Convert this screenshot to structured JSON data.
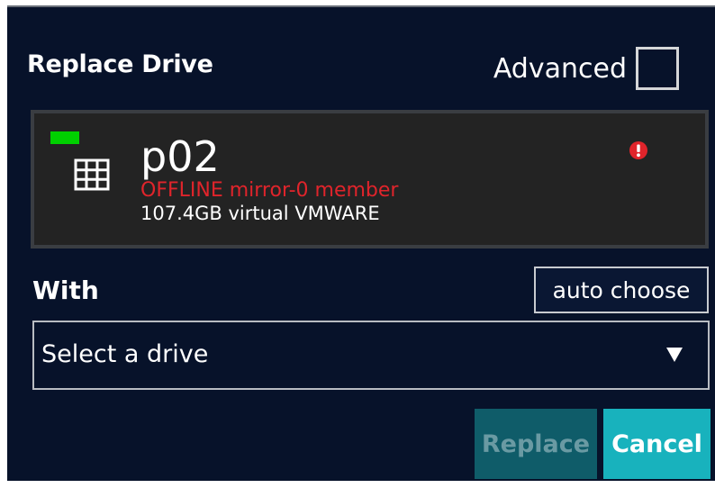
{
  "dialog": {
    "title": "Replace Drive",
    "advanced": {
      "label": "Advanced",
      "checked": false
    }
  },
  "drive": {
    "name": "p02",
    "status": "OFFLINE mirror-0 member",
    "info": "107.4GB virtual VMWARE",
    "status_led_color": "#00d000",
    "status_text_color": "#e0242b",
    "icons": {
      "device": "grid-icon",
      "alert": "alert-icon"
    }
  },
  "with": {
    "label": "With",
    "auto_choose_label": "auto choose",
    "select": {
      "value": "Select a drive",
      "icon": "chevron-down-icon"
    }
  },
  "actions": {
    "replace_label": "Replace",
    "replace_enabled": false,
    "cancel_label": "Cancel"
  },
  "colors": {
    "background": "#07122a",
    "card": "#232323",
    "accent": "#18b2bd",
    "accent_disabled": "#0f5c69"
  }
}
